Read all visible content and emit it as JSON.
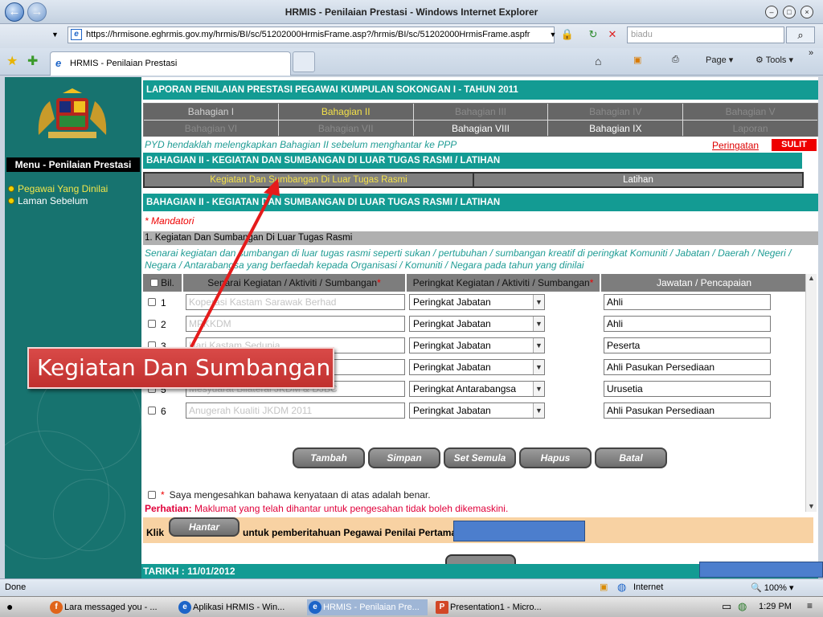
{
  "window": {
    "title": "HRMIS - Penilaian Prestasi - Windows Internet Explorer",
    "controls": [
      "minimize",
      "maximize",
      "close"
    ]
  },
  "browser": {
    "url": "https://hrmisone.eghrmis.gov.my/hrmis/BI/sc/51202000HrmisFrame.asp?/hrmis/BI/sc/51202000HrmisFrame.aspfr",
    "search_placeholder": "biadu",
    "tab_label": "HRMIS - Penilaian Prestasi",
    "commands": {
      "page": "Page",
      "tools": "Tools"
    }
  },
  "sidebar": {
    "menu_title": "Menu - Penilaian Prestasi",
    "items": [
      {
        "label": "Pegawai Yang Dinilai"
      },
      {
        "label": "Laman Sebelum"
      }
    ]
  },
  "page": {
    "report_title": "LAPORAN PENILAIAN PRESTASI PEGAWAI KUMPULAN SOKONGAN I - TAHUN 2011",
    "sections_row1": [
      "Bahagian I",
      "Bahagian II",
      "Bahagian III",
      "Bahagian IV",
      "Bahagian V"
    ],
    "sections_row2": [
      "Bahagian VI",
      "Bahagian VII",
      "Bahagian VIII",
      "Bahagian IX",
      "Laporan"
    ],
    "instruction": "PYD hendaklah melengkapkan Bahagian II sebelum menghantar ke PPP",
    "warning_link": "Peringatan",
    "classification": "SULIT",
    "section_title": "BAHAGIAN II - KEGIATAN DAN SUMBANGAN DI LUAR TUGAS RASMI / LATIHAN",
    "subtabs": [
      "Kegiatan Dan Sumbangan Di Luar Tugas Rasmi",
      "Latihan"
    ],
    "section_title2": "BAHAGIAN II - KEGIATAN DAN SUMBANGAN DI LUAR TUGAS RASMI / LATIHAN",
    "mandatory": "* Mandatori",
    "subsection": "1. Kegiatan Dan Sumbangan Di Luar Tugas Rasmi",
    "description": "Senarai kegiatan dan sumbangan di luar tugas rasmi seperti sukan / pertubuhan / sumbangan kreatif di peringkat Komuniti / Jabatan / Daerah / Negeri / Negara / Antarabangsa yang berfaedah kepada Organisasi / Komuniti / Negara pada tahun yang dinilai",
    "table": {
      "headers": [
        "Bil.",
        "Senarai Kegiatan / Aktiviti / Sumbangan",
        "Peringkat Kegiatan / Aktiviti / Sumbangan",
        "Jawatan / Pencapaian"
      ],
      "rows": [
        {
          "bil": "1",
          "kegiatan": "Koperasi Kastam Sarawak Berhad",
          "peringkat": "Peringkat Jabatan",
          "jawatan": "Ahli"
        },
        {
          "bil": "2",
          "kegiatan": "MPKKDM",
          "peringkat": "Peringkat Jabatan",
          "jawatan": "Ahli"
        },
        {
          "bil": "3",
          "kegiatan": "Hari Kastam Sedunia",
          "peringkat": "Peringkat Jabatan",
          "jawatan": "Peserta"
        },
        {
          "bil": "4",
          "kegiatan": "Pasukan Persediaan",
          "peringkat": "Peringkat Jabatan",
          "jawatan": "Ahli Pasukan Persediaan"
        },
        {
          "bil": "5",
          "kegiatan": "Mesyuarat Bilateral JKDM & DJBC",
          "peringkat": "Peringkat Antarabangsa",
          "jawatan": "Urusetia"
        },
        {
          "bil": "6",
          "kegiatan": "Anugerah Kualiti JKDM 2011",
          "peringkat": "Peringkat Jabatan",
          "jawatan": "Ahli Pasukan Persediaan"
        }
      ]
    },
    "buttons": [
      "Tambah",
      "Simpan",
      "Set Semula",
      "Hapus",
      "Batal"
    ],
    "confirm_text": "Saya mengesahkan bahawa kenyataan di atas adalah benar.",
    "perhatian_label": "Perhatian:",
    "perhatian_text": "Maklumat yang telah dihantar untuk pengesahan tidak boleh dikemaskini.",
    "klik_label": "Klik",
    "hantar_button": "Hantar",
    "klik_text": "untuk pemberitahuan Pegawai Penilai Pertama",
    "date": "TARIKH : 11/01/2012"
  },
  "annotation": {
    "callout": "Kegiatan Dan Sumbangan"
  },
  "statusbar": {
    "left": "Done",
    "zone": "Internet",
    "zoom": "100%"
  },
  "taskbar": {
    "tasks": [
      "Lara messaged you - ...",
      "Aplikasi HRMIS - Win...",
      "HRMIS - Penilaian Pre...",
      "Presentation1 - Micro..."
    ],
    "clock": "1:29 PM"
  }
}
